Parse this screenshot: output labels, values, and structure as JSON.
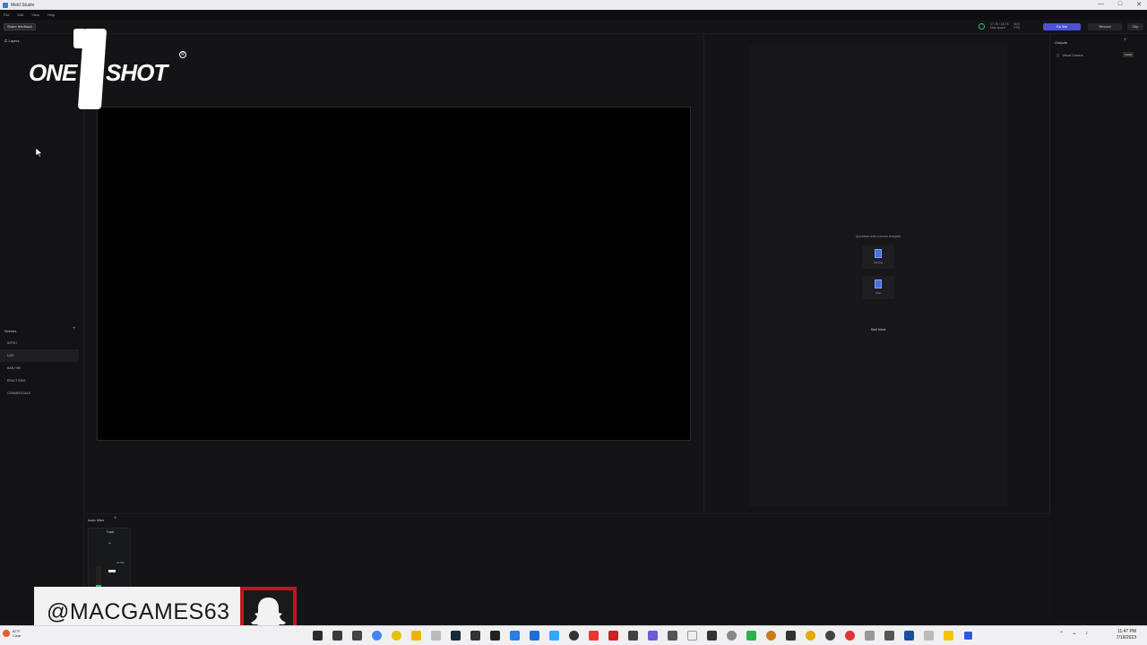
{
  "window": {
    "title": "Meld Studio",
    "minimize": "—",
    "maximize": "□",
    "close": "✕"
  },
  "menu": [
    "File",
    "Edit",
    "View",
    "Help"
  ],
  "toolbar": {
    "feedback": "Share feedback",
    "stat1": "17.76 / 18.78",
    "stat1_sub": "Disk space",
    "stat2": "60.0",
    "stat2_sub": "FPS",
    "go_live": "Go live",
    "record": "Record",
    "clip": "Clip"
  },
  "layers": {
    "title": "Layers"
  },
  "logo": {
    "left": "ONE",
    "right": "SHOT"
  },
  "scenes": {
    "title": "Scenes",
    "items": [
      "INTRO",
      "LIVE",
      "BAN HIM",
      "REACTIONS",
      "COMMERCIALS"
    ],
    "active_index": 1
  },
  "templates": {
    "heading": "Quickstart with a scene template",
    "items": [
      "Gaming",
      "Chat"
    ],
    "start_blank": "Start blank"
  },
  "outputs": {
    "title": "Outputs",
    "virtual_camera": "Virtual Camera",
    "install": "Install"
  },
  "mixer": {
    "title": "Audio Mixer",
    "track_label": "Track",
    "mute": "MUTE",
    "level": 0.3
  },
  "overlay": {
    "handle": "@MACGAMES63"
  },
  "taskbar": {
    "weather_temp": "82°F",
    "weather_desc": "Clear",
    "time": "11:47 PM",
    "date": "7/18/2023"
  },
  "colors": {
    "accent": "#4b52d8",
    "status_ok": "#2fbf71",
    "snap_red": "#c0171f"
  }
}
